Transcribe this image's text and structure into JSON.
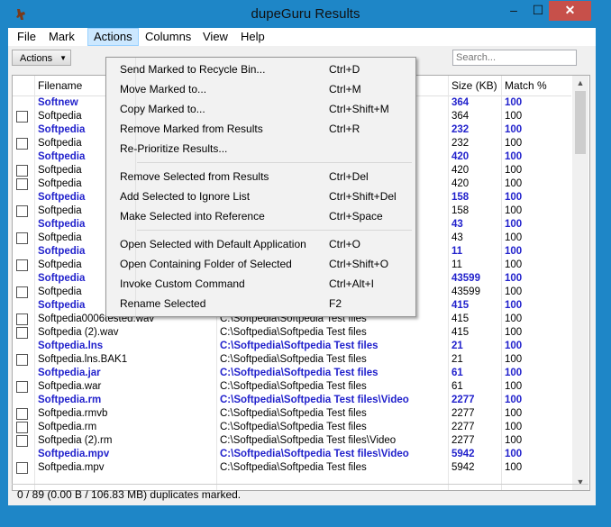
{
  "window": {
    "title": "dupeGuru Results",
    "minimize": "–",
    "maximize": "☐",
    "close": "✕"
  },
  "menubar": [
    "File",
    "Mark",
    "Actions",
    "Columns",
    "View",
    "Help"
  ],
  "toolbar": {
    "actions_label": "Actions",
    "search_placeholder": "Search..."
  },
  "columns": {
    "filename": "Filename",
    "size": "Size (KB)",
    "match": "Match %"
  },
  "rows": [
    {
      "name": "Softnew",
      "folder": "",
      "size": "364",
      "match": "100",
      "ref": true,
      "cb": false
    },
    {
      "name": "Softpedia",
      "folder": "",
      "size": "364",
      "match": "100",
      "ref": false,
      "cb": true
    },
    {
      "name": "Softpedia",
      "folder": "",
      "size": "232",
      "match": "100",
      "ref": true,
      "cb": false
    },
    {
      "name": "Softpedia",
      "folder": "",
      "size": "232",
      "match": "100",
      "ref": false,
      "cb": true
    },
    {
      "name": "Softpedia",
      "folder": "",
      "size": "420",
      "match": "100",
      "ref": true,
      "cb": false
    },
    {
      "name": "Softpedia",
      "folder": "",
      "size": "420",
      "match": "100",
      "ref": false,
      "cb": true
    },
    {
      "name": "Softpedia",
      "folder": "",
      "size": "420",
      "match": "100",
      "ref": false,
      "cb": true
    },
    {
      "name": "Softpedia",
      "folder": "",
      "size": "158",
      "match": "100",
      "ref": true,
      "cb": false
    },
    {
      "name": "Softpedia",
      "folder": "",
      "size": "158",
      "match": "100",
      "ref": false,
      "cb": true
    },
    {
      "name": "Softpedia",
      "folder": "",
      "size": "43",
      "match": "100",
      "ref": true,
      "cb": false
    },
    {
      "name": "Softpedia",
      "folder": "",
      "size": "43",
      "match": "100",
      "ref": false,
      "cb": true
    },
    {
      "name": "Softpedia",
      "folder": "",
      "size": "11",
      "match": "100",
      "ref": true,
      "cb": false
    },
    {
      "name": "Softpedia",
      "folder": "",
      "size": "11",
      "match": "100",
      "ref": false,
      "cb": true
    },
    {
      "name": "Softpedia",
      "folder": "a Ca...",
      "size": "43599",
      "match": "100",
      "ref": true,
      "cb": false
    },
    {
      "name": "Softpedia",
      "folder": "",
      "size": "43599",
      "match": "100",
      "ref": false,
      "cb": true
    },
    {
      "name": "Softpedia",
      "folder": "",
      "size": "415",
      "match": "100",
      "ref": true,
      "cb": false
    },
    {
      "name": "Softpedia0006tested.wav",
      "folder": "C:\\Softpedia\\Softpedia Test files",
      "size": "415",
      "match": "100",
      "ref": false,
      "cb": true
    },
    {
      "name": "Softpedia (2).wav",
      "folder": "C:\\Softpedia\\Softpedia Test files",
      "size": "415",
      "match": "100",
      "ref": false,
      "cb": true
    },
    {
      "name": "Softpedia.lns",
      "folder": "C:\\Softpedia\\Softpedia Test files",
      "size": "21",
      "match": "100",
      "ref": true,
      "cb": false
    },
    {
      "name": "Softpedia.lns.BAK1",
      "folder": "C:\\Softpedia\\Softpedia Test files",
      "size": "21",
      "match": "100",
      "ref": false,
      "cb": true
    },
    {
      "name": "Softpedia.jar",
      "folder": "C:\\Softpedia\\Softpedia Test files",
      "size": "61",
      "match": "100",
      "ref": true,
      "cb": false
    },
    {
      "name": "Softpedia.war",
      "folder": "C:\\Softpedia\\Softpedia Test files",
      "size": "61",
      "match": "100",
      "ref": false,
      "cb": true
    },
    {
      "name": "Softpedia.rm",
      "folder": "C:\\Softpedia\\Softpedia Test files\\Video",
      "size": "2277",
      "match": "100",
      "ref": true,
      "cb": false
    },
    {
      "name": "Softpedia.rmvb",
      "folder": "C:\\Softpedia\\Softpedia Test files",
      "size": "2277",
      "match": "100",
      "ref": false,
      "cb": true
    },
    {
      "name": "Softpedia.rm",
      "folder": "C:\\Softpedia\\Softpedia Test files",
      "size": "2277",
      "match": "100",
      "ref": false,
      "cb": true
    },
    {
      "name": "Softpedia (2).rm",
      "folder": "C:\\Softpedia\\Softpedia Test files\\Video",
      "size": "2277",
      "match": "100",
      "ref": false,
      "cb": true
    },
    {
      "name": "Softpedia.mpv",
      "folder": "C:\\Softpedia\\Softpedia Test files\\Video",
      "size": "5942",
      "match": "100",
      "ref": true,
      "cb": false
    },
    {
      "name": "Softpedia.mpv",
      "folder": "C:\\Softpedia\\Softpedia Test files",
      "size": "5942",
      "match": "100",
      "ref": false,
      "cb": true
    }
  ],
  "dropdown": [
    {
      "label": "Send Marked to Recycle Bin...",
      "shortcut": "Ctrl+D"
    },
    {
      "label": "Move Marked to...",
      "shortcut": "Ctrl+M"
    },
    {
      "label": "Copy Marked to...",
      "shortcut": "Ctrl+Shift+M"
    },
    {
      "label": "Remove Marked from Results",
      "shortcut": "Ctrl+R"
    },
    {
      "label": "Re-Prioritize Results...",
      "shortcut": ""
    },
    {
      "sep": true
    },
    {
      "label": "Remove Selected from Results",
      "shortcut": "Ctrl+Del"
    },
    {
      "label": "Add Selected to Ignore List",
      "shortcut": "Ctrl+Shift+Del"
    },
    {
      "label": "Make Selected into Reference",
      "shortcut": "Ctrl+Space"
    },
    {
      "sep": true
    },
    {
      "label": "Open Selected with Default Application",
      "shortcut": "Ctrl+O"
    },
    {
      "label": "Open Containing Folder of Selected",
      "shortcut": "Ctrl+Shift+O"
    },
    {
      "label": "Invoke Custom Command",
      "shortcut": "Ctrl+Alt+I"
    },
    {
      "label": "Rename Selected",
      "shortcut": "F2"
    }
  ],
  "status": "0 / 89 (0.00 B / 106.83 MB) duplicates marked."
}
